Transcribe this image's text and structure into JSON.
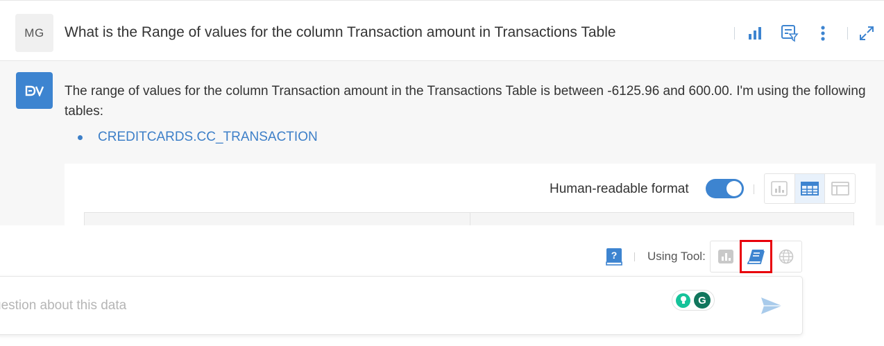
{
  "question": {
    "avatar_initials": "MG",
    "text": "What is the Range of values for the column Transaction amount in Transactions Table"
  },
  "question_actions": [
    {
      "icon": "bar-chart-icon"
    },
    {
      "icon": "filter-icon"
    },
    {
      "icon": "more-vertical-icon"
    },
    {
      "icon": "expand-icon"
    }
  ],
  "answer": {
    "avatar_icon": "dv-logo-icon",
    "text": "The range of values for the column Transaction amount in the Transactions Table is between -6125.96 and 600.00. I'm using the following tables:",
    "tables": [
      "CREDITCARDS.CC_TRANSACTION"
    ]
  },
  "result": {
    "human_readable_label": "Human-readable format",
    "human_readable_on": true,
    "view_modes": [
      "chart",
      "table",
      "card"
    ],
    "active_view": "table"
  },
  "composer": {
    "using_tool_label": "Using Tool:",
    "tools": [
      "chart-tool",
      "knowledge-book-tool",
      "web-globe-tool"
    ],
    "selected_tool": "knowledge-book-tool",
    "placeholder": "uestion about this data"
  },
  "colors": {
    "accent": "#3d84d0",
    "link": "#3d7fc8",
    "highlight": "#e8000b",
    "grammarly": "#15c39a"
  }
}
